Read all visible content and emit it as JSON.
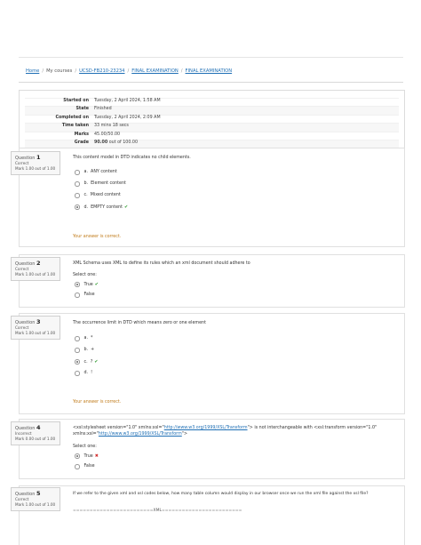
{
  "breadcrumb": {
    "home": "Home",
    "courses": "My courses",
    "course": "UCSD-FB210-23234",
    "section": "FINAL EXAMINATION",
    "page": "FINAL EXAMINATION",
    "sep": "/"
  },
  "summary": [
    {
      "label": "Started on",
      "value": "Tuesday, 2 April 2024, 1:58 AM"
    },
    {
      "label": "State",
      "value": "Finished"
    },
    {
      "label": "Completed on",
      "value": "Tuesday, 2 April 2024, 2:09 AM"
    },
    {
      "label": "Time taken",
      "value": "33 mins 18 secs"
    },
    {
      "label": "Marks",
      "value": "45.00/50.00"
    },
    {
      "label": "Grade",
      "value_bold": "90.00",
      "value": "out of 100.00"
    }
  ],
  "questions": [
    {
      "qprefix": "Question",
      "qnum": "1",
      "status": "Correct",
      "mark": "Mark 1.00 out of 1.00",
      "text": "This content model in DTD indicates no child elements.",
      "options": [
        {
          "letter": "a.",
          "text": "ANY content",
          "mark": ""
        },
        {
          "letter": "b.",
          "text": "Element content",
          "mark": ""
        },
        {
          "letter": "c.",
          "text": "Mixed content",
          "mark": ""
        },
        {
          "letter": "d.",
          "text": "EMPTY content",
          "mark": "✔"
        }
      ],
      "feedback": "Your answer is correct."
    },
    {
      "qprefix": "Question",
      "qnum": "2",
      "status": "Correct",
      "mark": "Mark 1.00 out of 1.00",
      "text": "XML Schema uses XML to define its rules which an xml document should adhere to",
      "select": "Select one:",
      "options": [
        {
          "text": "True",
          "mark": "✔"
        },
        {
          "text": "False",
          "mark": ""
        }
      ]
    },
    {
      "qprefix": "Question",
      "qnum": "3",
      "status": "Correct",
      "mark": "Mark 1.00 out of 1.00",
      "text": "The occurrence limit in DTD which means zero or one element",
      "options": [
        {
          "letter": "a.",
          "text": "*",
          "mark": ""
        },
        {
          "letter": "b.",
          "text": "+",
          "mark": ""
        },
        {
          "letter": "c.",
          "text": "?",
          "mark": "✔"
        },
        {
          "letter": "d.",
          "text": "!",
          "mark": ""
        }
      ],
      "feedback": "Your answer is correct."
    },
    {
      "qprefix": "Question",
      "qnum": "4",
      "status": "Incorrect",
      "mark": "Mark 0.00 out of 1.00",
      "text_a": "<xsl:stylesheet version=\"1.0\" xmlns:xsl=\"",
      "link": "http://www.w3.org/1999/XSL/Transform",
      "text_b": "\"> is not interchangeable with <xsl:transform version=\"1.0\"",
      "text_c": "xmlns:xsl=\"",
      "text_d": "\">",
      "select": "Select one:",
      "options": [
        {
          "text": "True",
          "mark": "✖"
        },
        {
          "text": "False",
          "mark": ""
        }
      ]
    },
    {
      "qprefix": "Question",
      "qnum": "5",
      "status": "Correct",
      "mark": "Mark 1.00 out of 1.00",
      "text": "If we refer to the given xml and xsl codes below, how many table column would display in our browser once we run the xml file against the xsl file?",
      "code": "========================XML========================"
    }
  ]
}
